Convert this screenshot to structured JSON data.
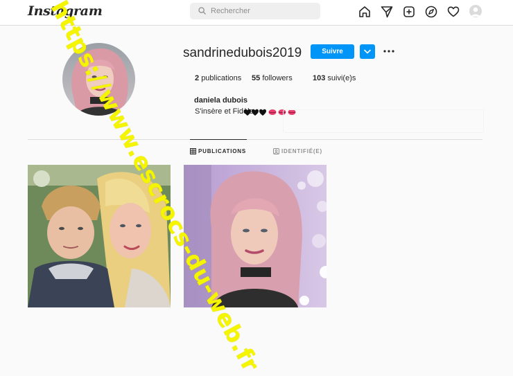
{
  "app": {
    "logo_text": "Instagram"
  },
  "search": {
    "placeholder": "Rechercher"
  },
  "nav": {
    "icons": [
      "home-icon",
      "direct-icon",
      "new-post-icon",
      "explore-icon",
      "activity-icon",
      "profile-avatar"
    ]
  },
  "profile": {
    "username": "sandrinedubois2019",
    "follow_label": "Suivre",
    "stats": {
      "posts_count": "2",
      "posts_label": "publications",
      "followers_count": "55",
      "followers_label": "followers",
      "following_count": "103",
      "following_label": "suivi(e)s"
    },
    "full_name": "daniela dubois",
    "bio_text": "S'insère et Fidèle",
    "bio_emojis": [
      "black-heart",
      "black-heart",
      "black-heart",
      "kiss-lips",
      "kiss-lips",
      "kiss-lips"
    ]
  },
  "tabs": [
    {
      "label": "PUBLICATIONS",
      "active": true
    },
    {
      "label": "IDENTIFIÉ(E)",
      "active": false
    }
  ],
  "posts": [
    {
      "description": "selfie-mother-and-son"
    },
    {
      "description": "selfie-woman-pink-hair"
    }
  ],
  "watermark": {
    "text": "https://www.escrocs-du-web.fr"
  },
  "colors": {
    "accent": "#0095f6",
    "watermark": "#f5f500",
    "border": "#dbdbdb"
  }
}
